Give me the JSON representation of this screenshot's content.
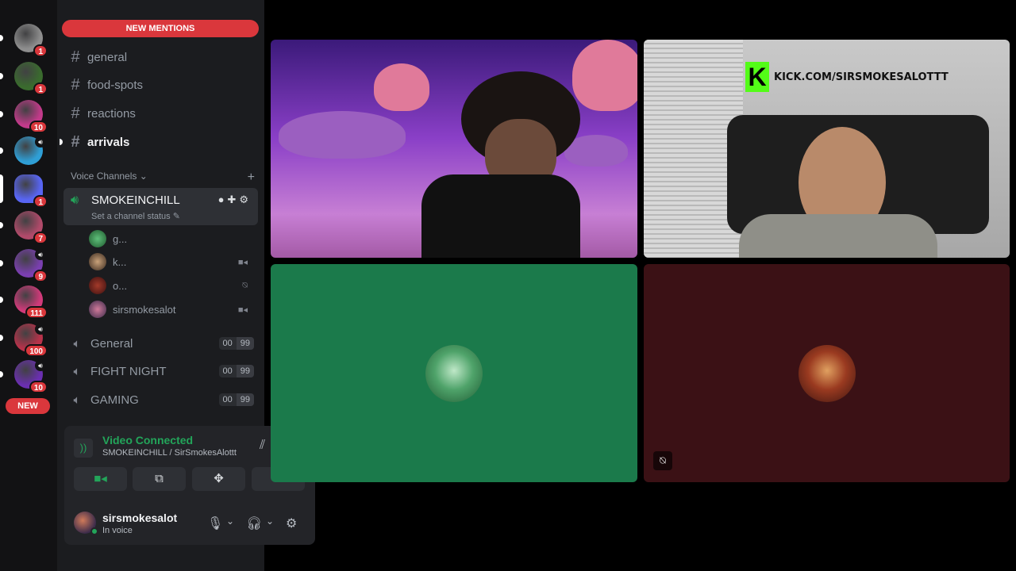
{
  "servers": [
    {
      "badge": "1",
      "speaker": false,
      "color": "#8e8e8e"
    },
    {
      "badge": "1",
      "speaker": false,
      "color": "#3a6b2e"
    },
    {
      "badge": "10",
      "speaker": false,
      "color": "#c23a8a"
    },
    {
      "badge": "",
      "speaker": true,
      "color": "#2f9fd6"
    },
    {
      "badge": "1",
      "speaker": false,
      "color": "#5865f2"
    },
    {
      "badge": "7",
      "speaker": false,
      "color": "#b04a6a"
    },
    {
      "badge": "9",
      "speaker": true,
      "color": "#7a3fb0"
    },
    {
      "badge": "111",
      "speaker": false,
      "color": "#d13a7a"
    },
    {
      "badge": "100",
      "speaker": true,
      "color": "#b8324a"
    },
    {
      "badge": "10",
      "speaker": true,
      "color": "#6a2fb0"
    }
  ],
  "new_pill": "NEW",
  "sidebar": {
    "mentions_pill": "NEW MENTIONS",
    "channels": [
      {
        "name": "general",
        "unread": false
      },
      {
        "name": "food-spots",
        "unread": false
      },
      {
        "name": "reactions",
        "unread": false
      },
      {
        "name": "arrivals",
        "unread": true
      }
    ],
    "voice_header": "Voice Channels",
    "active_voice": {
      "name": "SMOKEINCHILL",
      "status": "Set a channel status",
      "members": [
        {
          "name": "g...",
          "indicator": "",
          "color": "#2e8a4a"
        },
        {
          "name": "k...",
          "indicator": "video",
          "color": "#6a4a3a"
        },
        {
          "name": "o...",
          "indicator": "muted",
          "color": "#6a1f1f"
        },
        {
          "name": "sirsmokesalot",
          "indicator": "video",
          "color": "#8a4a6a"
        }
      ]
    },
    "voice_channels": [
      {
        "name": "General",
        "count": "00",
        "limit": "99"
      },
      {
        "name": "FIGHT NIGHT",
        "count": "00",
        "limit": "99"
      },
      {
        "name": "GAMING",
        "count": "00",
        "limit": "99"
      }
    ]
  },
  "rtc": {
    "title": "Video Connected",
    "subtitle": "SMOKEINCHILL / SirSmokesAlottt"
  },
  "user": {
    "name": "sirsmokesalot",
    "status": "In voice"
  },
  "tiles": {
    "kick_text": "KICK.COM/SIRSMOKESALOTTT"
  },
  "colors": {
    "accent_red": "#da373c",
    "connected_green": "#23a55a",
    "tile_green": "#1b7a4b",
    "tile_maroon": "#3b1115"
  }
}
